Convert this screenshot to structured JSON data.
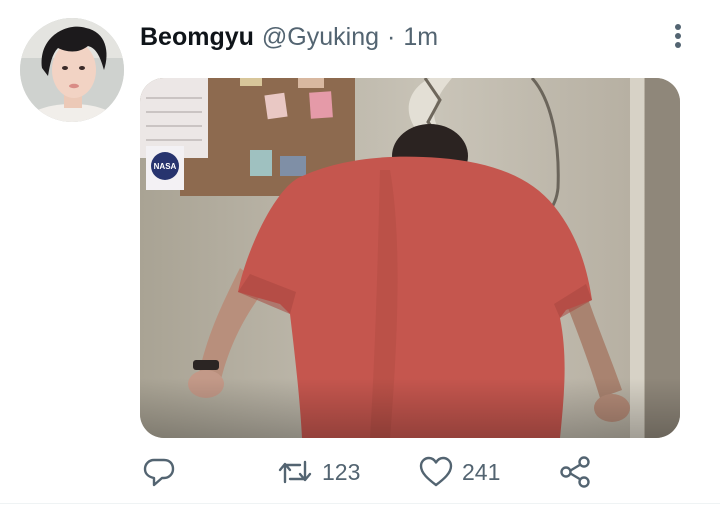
{
  "tweet": {
    "author_name": "Beomgyu",
    "author_handle": "@Gyuking",
    "separator": "·",
    "timestamp": "1m"
  },
  "media": {
    "sticker_text": "NASA"
  },
  "actions": {
    "retweet_count": "123",
    "like_count": "241"
  },
  "icons": {
    "reply": "reply-icon",
    "retweet": "retweet-icon",
    "like": "heart-icon",
    "share": "share-icon",
    "more": "more-vertical-icon"
  },
  "colors": {
    "icon_gray": "#536471",
    "shirt_red": "#c5564e"
  }
}
